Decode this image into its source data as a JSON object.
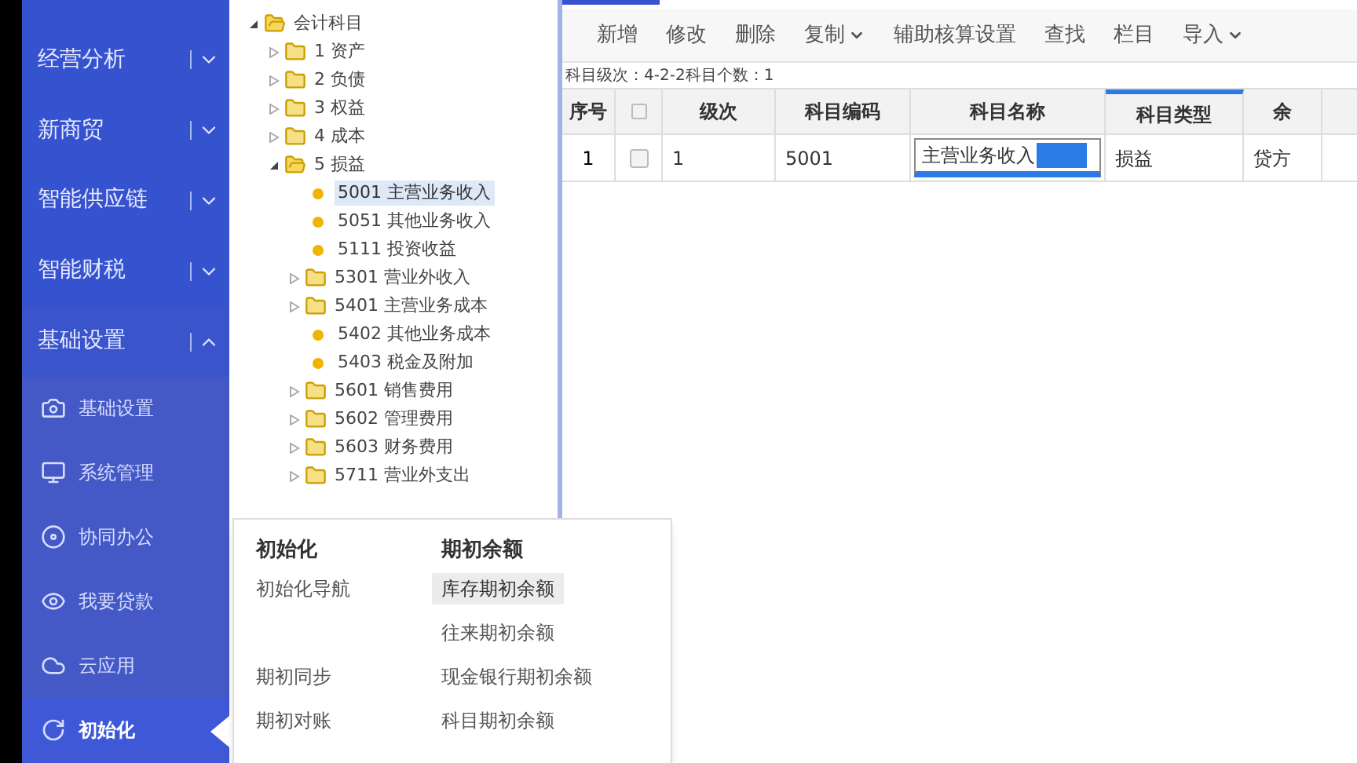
{
  "sidebar": {
    "sections": [
      {
        "label": "经营分析",
        "expanded": false
      },
      {
        "label": "新商贸",
        "expanded": false
      },
      {
        "label": "智能供应链",
        "expanded": false
      },
      {
        "label": "智能财税",
        "expanded": false
      },
      {
        "label": "基础设置",
        "expanded": true
      }
    ],
    "items": [
      {
        "label": "基础设置",
        "kind": "camera",
        "selected": false
      },
      {
        "label": "系统管理",
        "kind": "monitor",
        "selected": false
      },
      {
        "label": "协同办公",
        "kind": "orbit",
        "selected": false
      },
      {
        "label": "我要贷款",
        "kind": "eye",
        "selected": false
      },
      {
        "label": "云应用",
        "kind": "cloud",
        "selected": false
      },
      {
        "label": "初始化",
        "kind": "refresh",
        "selected": true
      }
    ]
  },
  "tree": [
    {
      "label": "会计科目",
      "kind": "folder",
      "expanded": true,
      "selected": false,
      "children": [
        {
          "label": "1 资产",
          "kind": "folder",
          "expanded": false,
          "selected": false
        },
        {
          "label": "2 负债",
          "kind": "folder",
          "expanded": false,
          "selected": false
        },
        {
          "label": "3 权益",
          "kind": "folder",
          "expanded": false,
          "selected": false
        },
        {
          "label": "4 成本",
          "kind": "folder",
          "expanded": false,
          "selected": false
        },
        {
          "label": "5 损益",
          "kind": "folder",
          "expanded": true,
          "selected": false,
          "children": [
            {
              "label": "5001 主营业务收入",
              "kind": "leaf",
              "selected": true
            },
            {
              "label": "5051 其他业务收入",
              "kind": "leaf",
              "selected": false
            },
            {
              "label": "5111 投资收益",
              "kind": "leaf",
              "selected": false
            },
            {
              "label": "5301 营业外收入",
              "kind": "folder",
              "expanded": false,
              "selected": false
            },
            {
              "label": "5401 主营业务成本",
              "kind": "folder",
              "expanded": false,
              "selected": false
            },
            {
              "label": "5402 其他业务成本",
              "kind": "leaf",
              "selected": false
            },
            {
              "label": "5403 税金及附加",
              "kind": "leaf",
              "selected": false
            },
            {
              "label": "5601 销售费用",
              "kind": "folder",
              "expanded": false,
              "selected": false
            },
            {
              "label": "5602 管理费用",
              "kind": "folder",
              "expanded": false,
              "selected": false
            },
            {
              "label": "5603 财务费用",
              "kind": "folder",
              "expanded": false,
              "selected": false
            },
            {
              "label": "5711 营业外支出",
              "kind": "folder",
              "expanded": false,
              "selected": false
            }
          ]
        }
      ]
    }
  ],
  "toolbar": [
    {
      "label": "新增",
      "dropdown": false
    },
    {
      "label": "修改",
      "dropdown": false
    },
    {
      "label": "删除",
      "dropdown": false
    },
    {
      "label": "复制",
      "dropdown": true
    },
    {
      "label": "辅助核算设置",
      "dropdown": false
    },
    {
      "label": "查找",
      "dropdown": false
    },
    {
      "label": "栏目",
      "dropdown": false
    },
    {
      "label": "导入",
      "dropdown": true
    }
  ],
  "info": {
    "level_label": "科目级次：",
    "level_value": "4-2-2",
    "count_label": "科目个数：",
    "count_value": "1"
  },
  "table": {
    "columns": [
      "序号",
      "",
      "级次",
      "科目编码",
      "科目名称",
      "科目类型",
      "余"
    ],
    "rows": [
      {
        "checked": false,
        "cells": [
          "1",
          "",
          "1",
          "5001",
          "主营业务收入",
          "损益",
          "贷方"
        ]
      }
    ]
  },
  "menu": {
    "columns": [
      {
        "title": "初始化",
        "items": [
          {
            "label": "初始化导航",
            "selected": false
          },
          {
            "label": "期初同步",
            "selected": false
          },
          {
            "label": "期初对账",
            "selected": false
          }
        ]
      },
      {
        "title": "期初余额",
        "items": [
          {
            "label": "库存期初余额",
            "selected": true
          },
          {
            "label": "往来期初余额",
            "selected": false
          },
          {
            "label": "现金银行期初余额",
            "selected": false
          },
          {
            "label": "科目期初余额",
            "selected": false
          }
        ]
      }
    ]
  }
}
